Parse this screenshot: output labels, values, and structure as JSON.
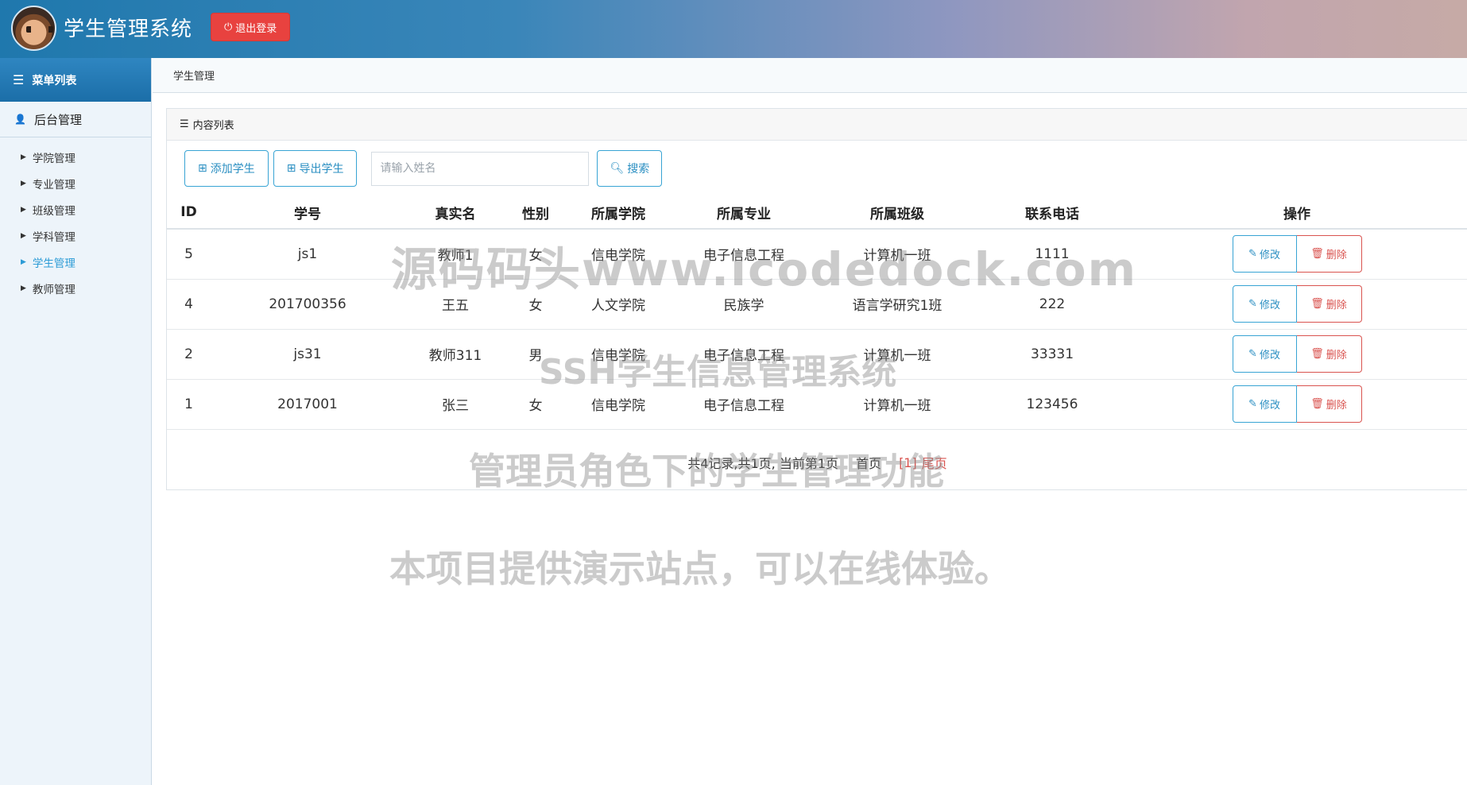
{
  "header": {
    "title": "学生管理系统",
    "logout_label": "退出登录",
    "accent": "#1f78ad",
    "danger": "#e8423f"
  },
  "sidebar": {
    "menu_title": "菜单列表",
    "group_label": "后台管理",
    "items": [
      {
        "label": "学院管理",
        "active": false
      },
      {
        "label": "专业管理",
        "active": false
      },
      {
        "label": "班级管理",
        "active": false
      },
      {
        "label": "学科管理",
        "active": false
      },
      {
        "label": "学生管理",
        "active": true
      },
      {
        "label": "教师管理",
        "active": false
      }
    ]
  },
  "breadcrumb": "学生管理",
  "panel": {
    "heading": "内容列表",
    "add_label": "添加学生",
    "export_label": "导出学生",
    "search_placeholder": "请输入姓名",
    "search_label": "搜索"
  },
  "table": {
    "headers": [
      "ID",
      "学号",
      "真实名",
      "性别",
      "所属学院",
      "所属专业",
      "所属班级",
      "联系电话",
      "操作"
    ],
    "rows": [
      [
        "5",
        "js1",
        "教师1",
        "女",
        "信电学院",
        "电子信息工程",
        "计算机一班",
        "1111"
      ],
      [
        "4",
        "201700356",
        "王五",
        "女",
        "人文学院",
        "民族学",
        "语言学研究1班",
        "222"
      ],
      [
        "2",
        "js31",
        "教师311",
        "男",
        "信电学院",
        "电子信息工程",
        "计算机一班",
        "33331"
      ],
      [
        "1",
        "2017001",
        "张三",
        "女",
        "信电学院",
        "电子信息工程",
        "计算机一班",
        "123456"
      ]
    ],
    "edit_label": "修改",
    "delete_label": "删除"
  },
  "pager": {
    "summary": "共4记录,共1页, 当前第1页",
    "first": "首页",
    "current": "[1]",
    "last": "尾页"
  },
  "watermark": {
    "line1": "源码码头www.icodedock.com",
    "line2": "SSH学生信息管理系统",
    "line3": "管理员角色下的学生管理功能",
    "line4": "本项目提供演示站点，可以在线体验。"
  }
}
